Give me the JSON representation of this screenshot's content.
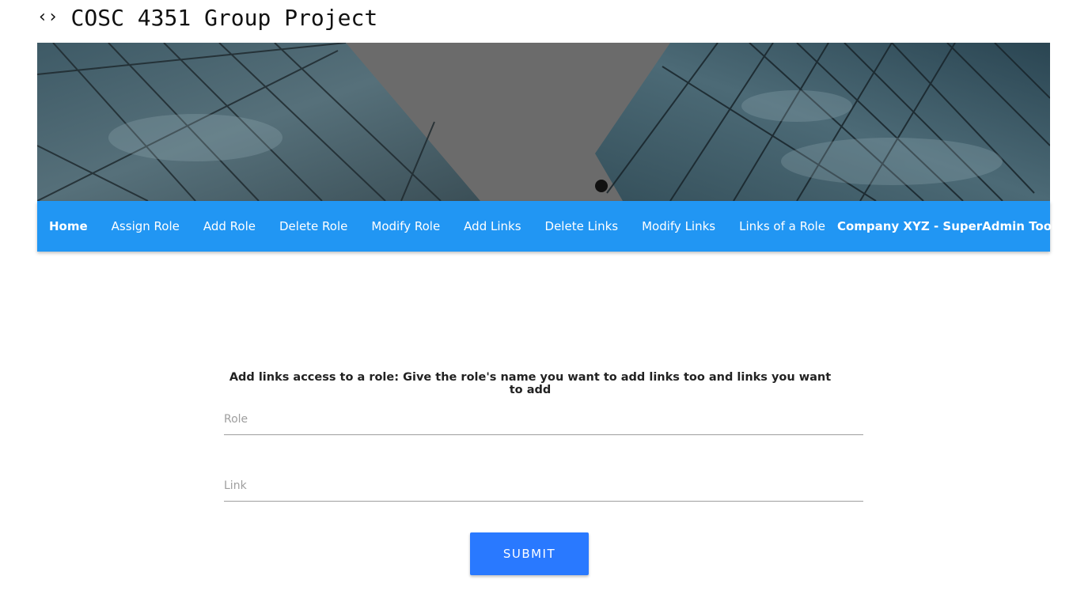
{
  "header": {
    "icon": "code-icon",
    "title": "COSC 4351 Group Project"
  },
  "navbar": {
    "color": "#2196f3",
    "items": [
      {
        "label": "Home"
      },
      {
        "label": "Assign Role"
      },
      {
        "label": "Add Role"
      },
      {
        "label": "Delete Role"
      },
      {
        "label": "Modify Role"
      },
      {
        "label": "Add Links"
      },
      {
        "label": "Delete Links"
      },
      {
        "label": "Modify Links"
      },
      {
        "label": "Links of a Role"
      }
    ],
    "brand": "Company XYZ - SuperAdmin Tools"
  },
  "form": {
    "heading": "Add links access to a role: Give the role's name you want to add links too and links you want to add",
    "role_placeholder": "Role",
    "role_value": "",
    "link_placeholder": "Link",
    "link_value": "",
    "submit_label": "SUBMIT",
    "submit_color": "#2979ff"
  }
}
